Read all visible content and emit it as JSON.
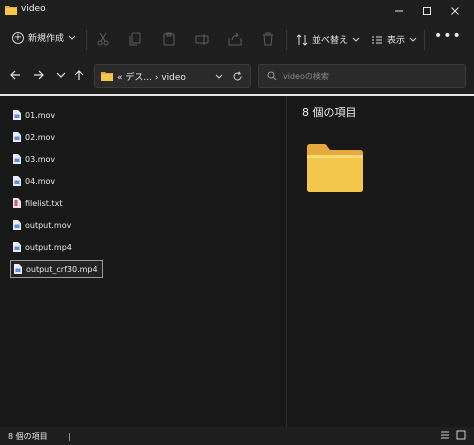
{
  "window": {
    "title": "video",
    "icons": {
      "folder": "folder-icon",
      "minimize": "minimize-icon",
      "maximize": "maximize-icon",
      "close": "close-icon"
    }
  },
  "toolbar": {
    "new_label": "新規作成",
    "sort_label": "並べ替え",
    "view_label": "表示",
    "more_label": "•••",
    "disabled_icons": [
      "cut-icon",
      "copy-icon",
      "paste-icon",
      "rename-icon",
      "share-icon",
      "delete-icon"
    ]
  },
  "navigation": {
    "address": {
      "prefix": "«",
      "parent": "デス...",
      "separator": "›",
      "current": "video"
    },
    "search": {
      "placeholder": "videoの検索"
    }
  },
  "files": [
    {
      "name": "01.mov",
      "type": "video"
    },
    {
      "name": "02.mov",
      "type": "video"
    },
    {
      "name": "03.mov",
      "type": "video"
    },
    {
      "name": "04.mov",
      "type": "video"
    },
    {
      "name": "filelist.txt",
      "type": "text"
    },
    {
      "name": "output.mov",
      "type": "video"
    },
    {
      "name": "output.mp4",
      "type": "video"
    },
    {
      "name": "output_crf30.mp4",
      "type": "video",
      "selected": true
    }
  ],
  "details": {
    "title": "8 個の項目"
  },
  "status": {
    "count": "8 個の項目",
    "separator": "|"
  },
  "colors": {
    "background": "#191919",
    "chrome": "#1f1f1f",
    "folder": "#f3c74c",
    "video_icon": "#5b8fd6",
    "text_icon": "#d94f8a"
  }
}
